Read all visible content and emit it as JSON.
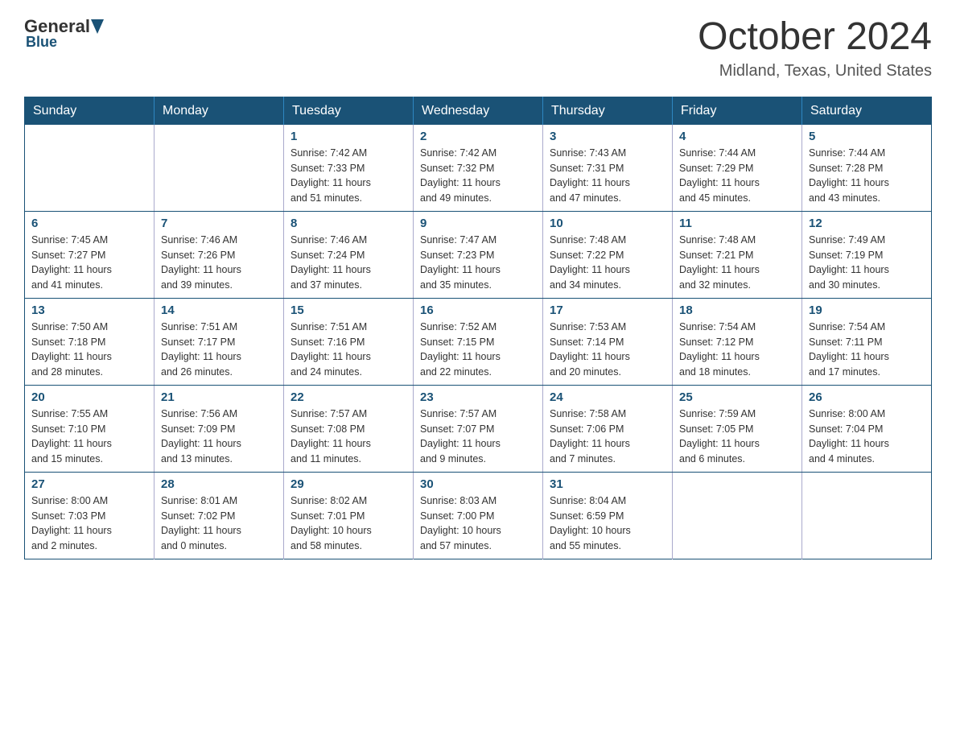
{
  "header": {
    "logo_general": "General",
    "logo_blue": "Blue",
    "title": "October 2024",
    "location": "Midland, Texas, United States"
  },
  "days_of_week": [
    "Sunday",
    "Monday",
    "Tuesday",
    "Wednesday",
    "Thursday",
    "Friday",
    "Saturday"
  ],
  "weeks": [
    [
      {
        "day": "",
        "info": ""
      },
      {
        "day": "",
        "info": ""
      },
      {
        "day": "1",
        "info": "Sunrise: 7:42 AM\nSunset: 7:33 PM\nDaylight: 11 hours\nand 51 minutes."
      },
      {
        "day": "2",
        "info": "Sunrise: 7:42 AM\nSunset: 7:32 PM\nDaylight: 11 hours\nand 49 minutes."
      },
      {
        "day": "3",
        "info": "Sunrise: 7:43 AM\nSunset: 7:31 PM\nDaylight: 11 hours\nand 47 minutes."
      },
      {
        "day": "4",
        "info": "Sunrise: 7:44 AM\nSunset: 7:29 PM\nDaylight: 11 hours\nand 45 minutes."
      },
      {
        "day": "5",
        "info": "Sunrise: 7:44 AM\nSunset: 7:28 PM\nDaylight: 11 hours\nand 43 minutes."
      }
    ],
    [
      {
        "day": "6",
        "info": "Sunrise: 7:45 AM\nSunset: 7:27 PM\nDaylight: 11 hours\nand 41 minutes."
      },
      {
        "day": "7",
        "info": "Sunrise: 7:46 AM\nSunset: 7:26 PM\nDaylight: 11 hours\nand 39 minutes."
      },
      {
        "day": "8",
        "info": "Sunrise: 7:46 AM\nSunset: 7:24 PM\nDaylight: 11 hours\nand 37 minutes."
      },
      {
        "day": "9",
        "info": "Sunrise: 7:47 AM\nSunset: 7:23 PM\nDaylight: 11 hours\nand 35 minutes."
      },
      {
        "day": "10",
        "info": "Sunrise: 7:48 AM\nSunset: 7:22 PM\nDaylight: 11 hours\nand 34 minutes."
      },
      {
        "day": "11",
        "info": "Sunrise: 7:48 AM\nSunset: 7:21 PM\nDaylight: 11 hours\nand 32 minutes."
      },
      {
        "day": "12",
        "info": "Sunrise: 7:49 AM\nSunset: 7:19 PM\nDaylight: 11 hours\nand 30 minutes."
      }
    ],
    [
      {
        "day": "13",
        "info": "Sunrise: 7:50 AM\nSunset: 7:18 PM\nDaylight: 11 hours\nand 28 minutes."
      },
      {
        "day": "14",
        "info": "Sunrise: 7:51 AM\nSunset: 7:17 PM\nDaylight: 11 hours\nand 26 minutes."
      },
      {
        "day": "15",
        "info": "Sunrise: 7:51 AM\nSunset: 7:16 PM\nDaylight: 11 hours\nand 24 minutes."
      },
      {
        "day": "16",
        "info": "Sunrise: 7:52 AM\nSunset: 7:15 PM\nDaylight: 11 hours\nand 22 minutes."
      },
      {
        "day": "17",
        "info": "Sunrise: 7:53 AM\nSunset: 7:14 PM\nDaylight: 11 hours\nand 20 minutes."
      },
      {
        "day": "18",
        "info": "Sunrise: 7:54 AM\nSunset: 7:12 PM\nDaylight: 11 hours\nand 18 minutes."
      },
      {
        "day": "19",
        "info": "Sunrise: 7:54 AM\nSunset: 7:11 PM\nDaylight: 11 hours\nand 17 minutes."
      }
    ],
    [
      {
        "day": "20",
        "info": "Sunrise: 7:55 AM\nSunset: 7:10 PM\nDaylight: 11 hours\nand 15 minutes."
      },
      {
        "day": "21",
        "info": "Sunrise: 7:56 AM\nSunset: 7:09 PM\nDaylight: 11 hours\nand 13 minutes."
      },
      {
        "day": "22",
        "info": "Sunrise: 7:57 AM\nSunset: 7:08 PM\nDaylight: 11 hours\nand 11 minutes."
      },
      {
        "day": "23",
        "info": "Sunrise: 7:57 AM\nSunset: 7:07 PM\nDaylight: 11 hours\nand 9 minutes."
      },
      {
        "day": "24",
        "info": "Sunrise: 7:58 AM\nSunset: 7:06 PM\nDaylight: 11 hours\nand 7 minutes."
      },
      {
        "day": "25",
        "info": "Sunrise: 7:59 AM\nSunset: 7:05 PM\nDaylight: 11 hours\nand 6 minutes."
      },
      {
        "day": "26",
        "info": "Sunrise: 8:00 AM\nSunset: 7:04 PM\nDaylight: 11 hours\nand 4 minutes."
      }
    ],
    [
      {
        "day": "27",
        "info": "Sunrise: 8:00 AM\nSunset: 7:03 PM\nDaylight: 11 hours\nand 2 minutes."
      },
      {
        "day": "28",
        "info": "Sunrise: 8:01 AM\nSunset: 7:02 PM\nDaylight: 11 hours\nand 0 minutes."
      },
      {
        "day": "29",
        "info": "Sunrise: 8:02 AM\nSunset: 7:01 PM\nDaylight: 10 hours\nand 58 minutes."
      },
      {
        "day": "30",
        "info": "Sunrise: 8:03 AM\nSunset: 7:00 PM\nDaylight: 10 hours\nand 57 minutes."
      },
      {
        "day": "31",
        "info": "Sunrise: 8:04 AM\nSunset: 6:59 PM\nDaylight: 10 hours\nand 55 minutes."
      },
      {
        "day": "",
        "info": ""
      },
      {
        "day": "",
        "info": ""
      }
    ]
  ]
}
